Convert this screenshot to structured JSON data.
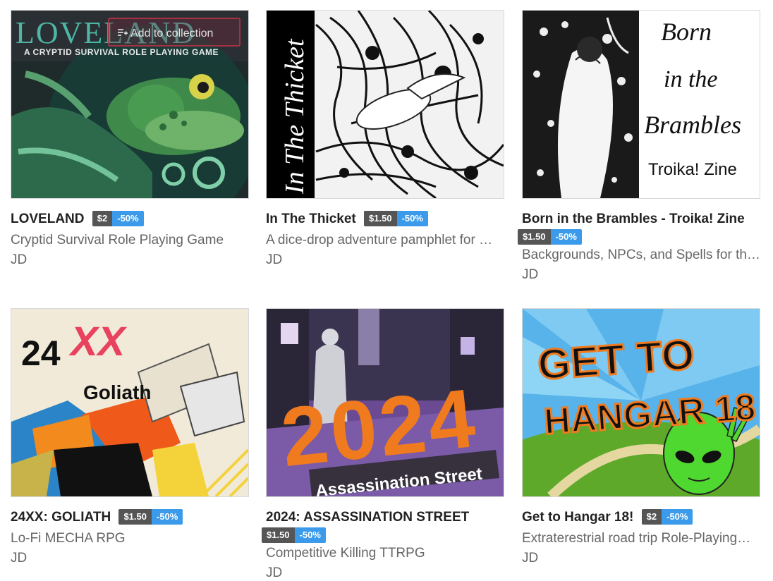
{
  "overlay": {
    "add_to_collection": "Add to collection"
  },
  "games": [
    {
      "title": "LOVELAND",
      "price": "$2",
      "sale": "-50%",
      "desc": "Cryptid Survival Role Playing Game",
      "author": "JD",
      "cover": {
        "heading": "LOVELAND",
        "subheading": "A CRYPTID SURVIVAL ROLE PLAYING GAME"
      }
    },
    {
      "title": "In The Thicket",
      "price": "$1.50",
      "sale": "-50%",
      "desc": "A dice-drop adventure pamphlet for …",
      "author": "JD",
      "cover": {
        "heading": "In The Thicket"
      }
    },
    {
      "title": "Born in the Brambles - Troika! Zine",
      "price": "$1.50",
      "sale": "-50%",
      "desc": "Backgrounds, NPCs, and Spells for th…",
      "author": "JD",
      "cover": {
        "line1": "Born",
        "line2": "in the",
        "line3": "Brambles",
        "line4": "Troika! Zine"
      }
    },
    {
      "title": "24XX: GOLIATH",
      "price": "$1.50",
      "sale": "-50%",
      "desc": "Lo-Fi MECHA RPG",
      "author": "JD",
      "cover": {
        "num": "24",
        "xx": "XX",
        "name": "Goliath"
      }
    },
    {
      "title": "2024: ASSASSINATION STREET",
      "price": "$1.50",
      "sale": "-50%",
      "desc": "Competitive Killing TTRPG",
      "author": "JD",
      "cover": {
        "year": "2024",
        "street": "Assassination Street"
      }
    },
    {
      "title": "Get to Hangar 18!",
      "price": "$2",
      "sale": "-50%",
      "desc": "Extraterestrial road trip Role-Playing…",
      "author": "JD",
      "cover": {
        "line1": "GET TO",
        "line2": "HANGAR 18"
      }
    }
  ]
}
